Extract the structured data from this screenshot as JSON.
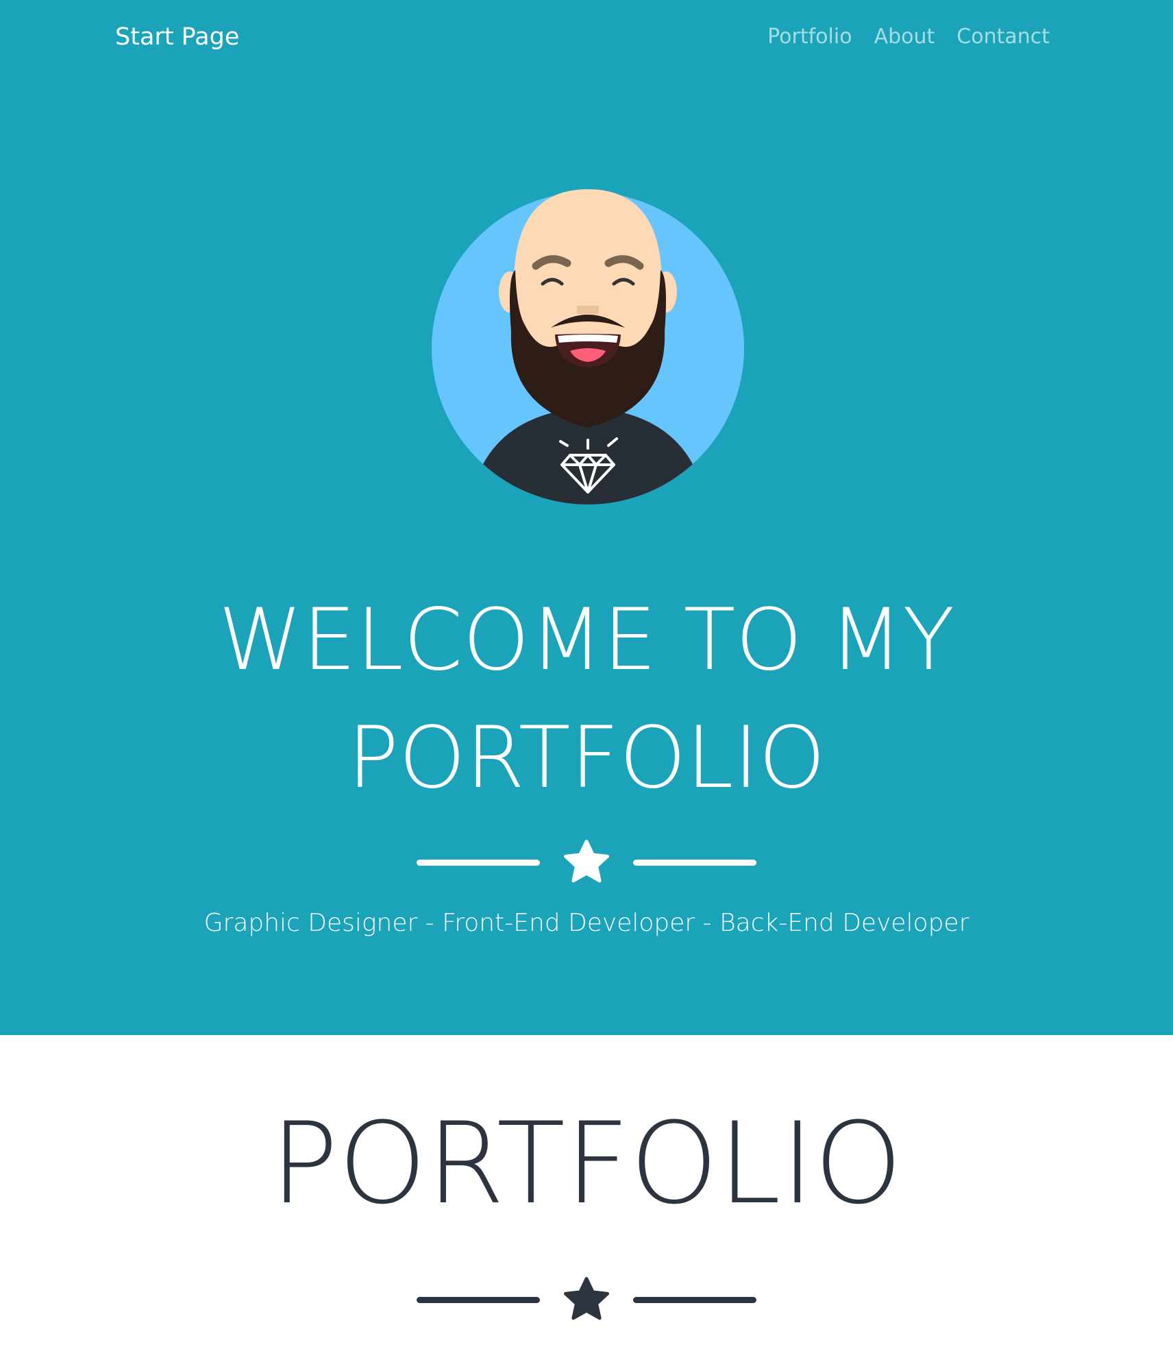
{
  "navbar": {
    "brand": "Start Page",
    "links": [
      "Portfolio",
      "About",
      "Contanct"
    ]
  },
  "hero": {
    "title": "WELCOME TO MY PORTFOLIO",
    "subtitle": "Graphic Designer - Front-End Developer - Back-End Developer",
    "divider_icon": "star-icon"
  },
  "portfolio": {
    "title": "PORTFOLIO",
    "divider_icon": "star-icon"
  },
  "colors": {
    "primary": "#1aa3b9",
    "text_light": "#ffffff",
    "text_dark": "#2c3440",
    "avatar_bg": "#67c5fd"
  }
}
